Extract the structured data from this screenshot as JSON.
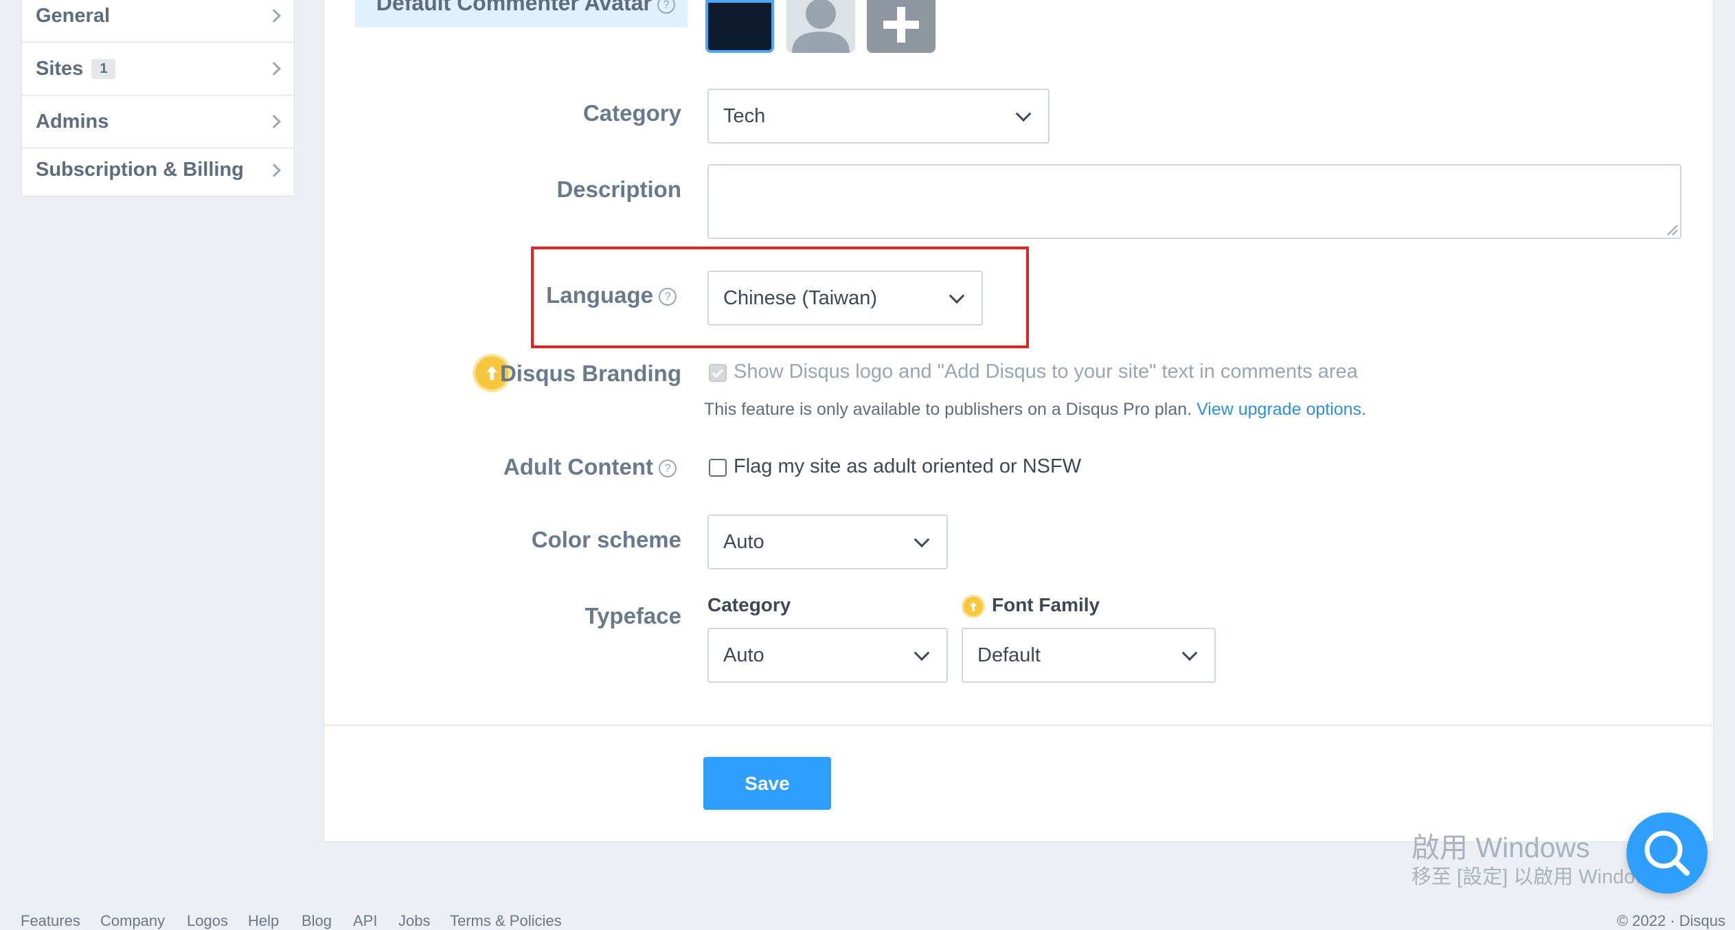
{
  "sidebar": {
    "items": [
      {
        "label": "General"
      },
      {
        "label": "Sites",
        "badge": "1"
      },
      {
        "label": "Admins"
      },
      {
        "label": "Subscription & Billing"
      }
    ]
  },
  "form": {
    "avatar_label": "Default Commenter Avatar",
    "category": {
      "label": "Category",
      "value": "Tech"
    },
    "description": {
      "label": "Description",
      "value": ""
    },
    "language": {
      "label": "Language",
      "value": "Chinese (Taiwan)"
    },
    "branding": {
      "label": "Disqus Branding",
      "checkbox_text": "Show Disqus logo and \"Add Disqus to your site\" text in comments area",
      "note_text": "This feature is only available to publishers on a Disqus Pro plan.",
      "note_link": "View upgrade options",
      "note_end": "."
    },
    "adult": {
      "label": "Adult Content",
      "checkbox_text": "Flag my site as adult oriented or NSFW"
    },
    "color_scheme": {
      "label": "Color scheme",
      "value": "Auto"
    },
    "typeface": {
      "label": "Typeface",
      "category_label": "Category",
      "category_value": "Auto",
      "font_family_label": "Font Family",
      "font_family_value": "Default"
    },
    "save_label": "Save"
  },
  "watermark": {
    "line1": "啟用 Windows",
    "line2": "移至 [設定] 以啟用 Windows。"
  },
  "footer": {
    "links": [
      "Features",
      "Company",
      "Logos",
      "Help",
      "Blog",
      "API",
      "Jobs",
      "Terms & Policies"
    ],
    "copyright": "© 2022 · Disqus"
  },
  "colors": {
    "accent": "#2e9fff",
    "highlight_border": "#e02424",
    "upgrade": "#f7c83e"
  },
  "icons": {
    "help": "question-mark-circle-icon",
    "upgrade": "arrow-up-circle-icon",
    "chevron": "chevron-right-icon",
    "caret": "chevron-down-icon",
    "search": "search-icon",
    "plus": "plus-icon"
  }
}
